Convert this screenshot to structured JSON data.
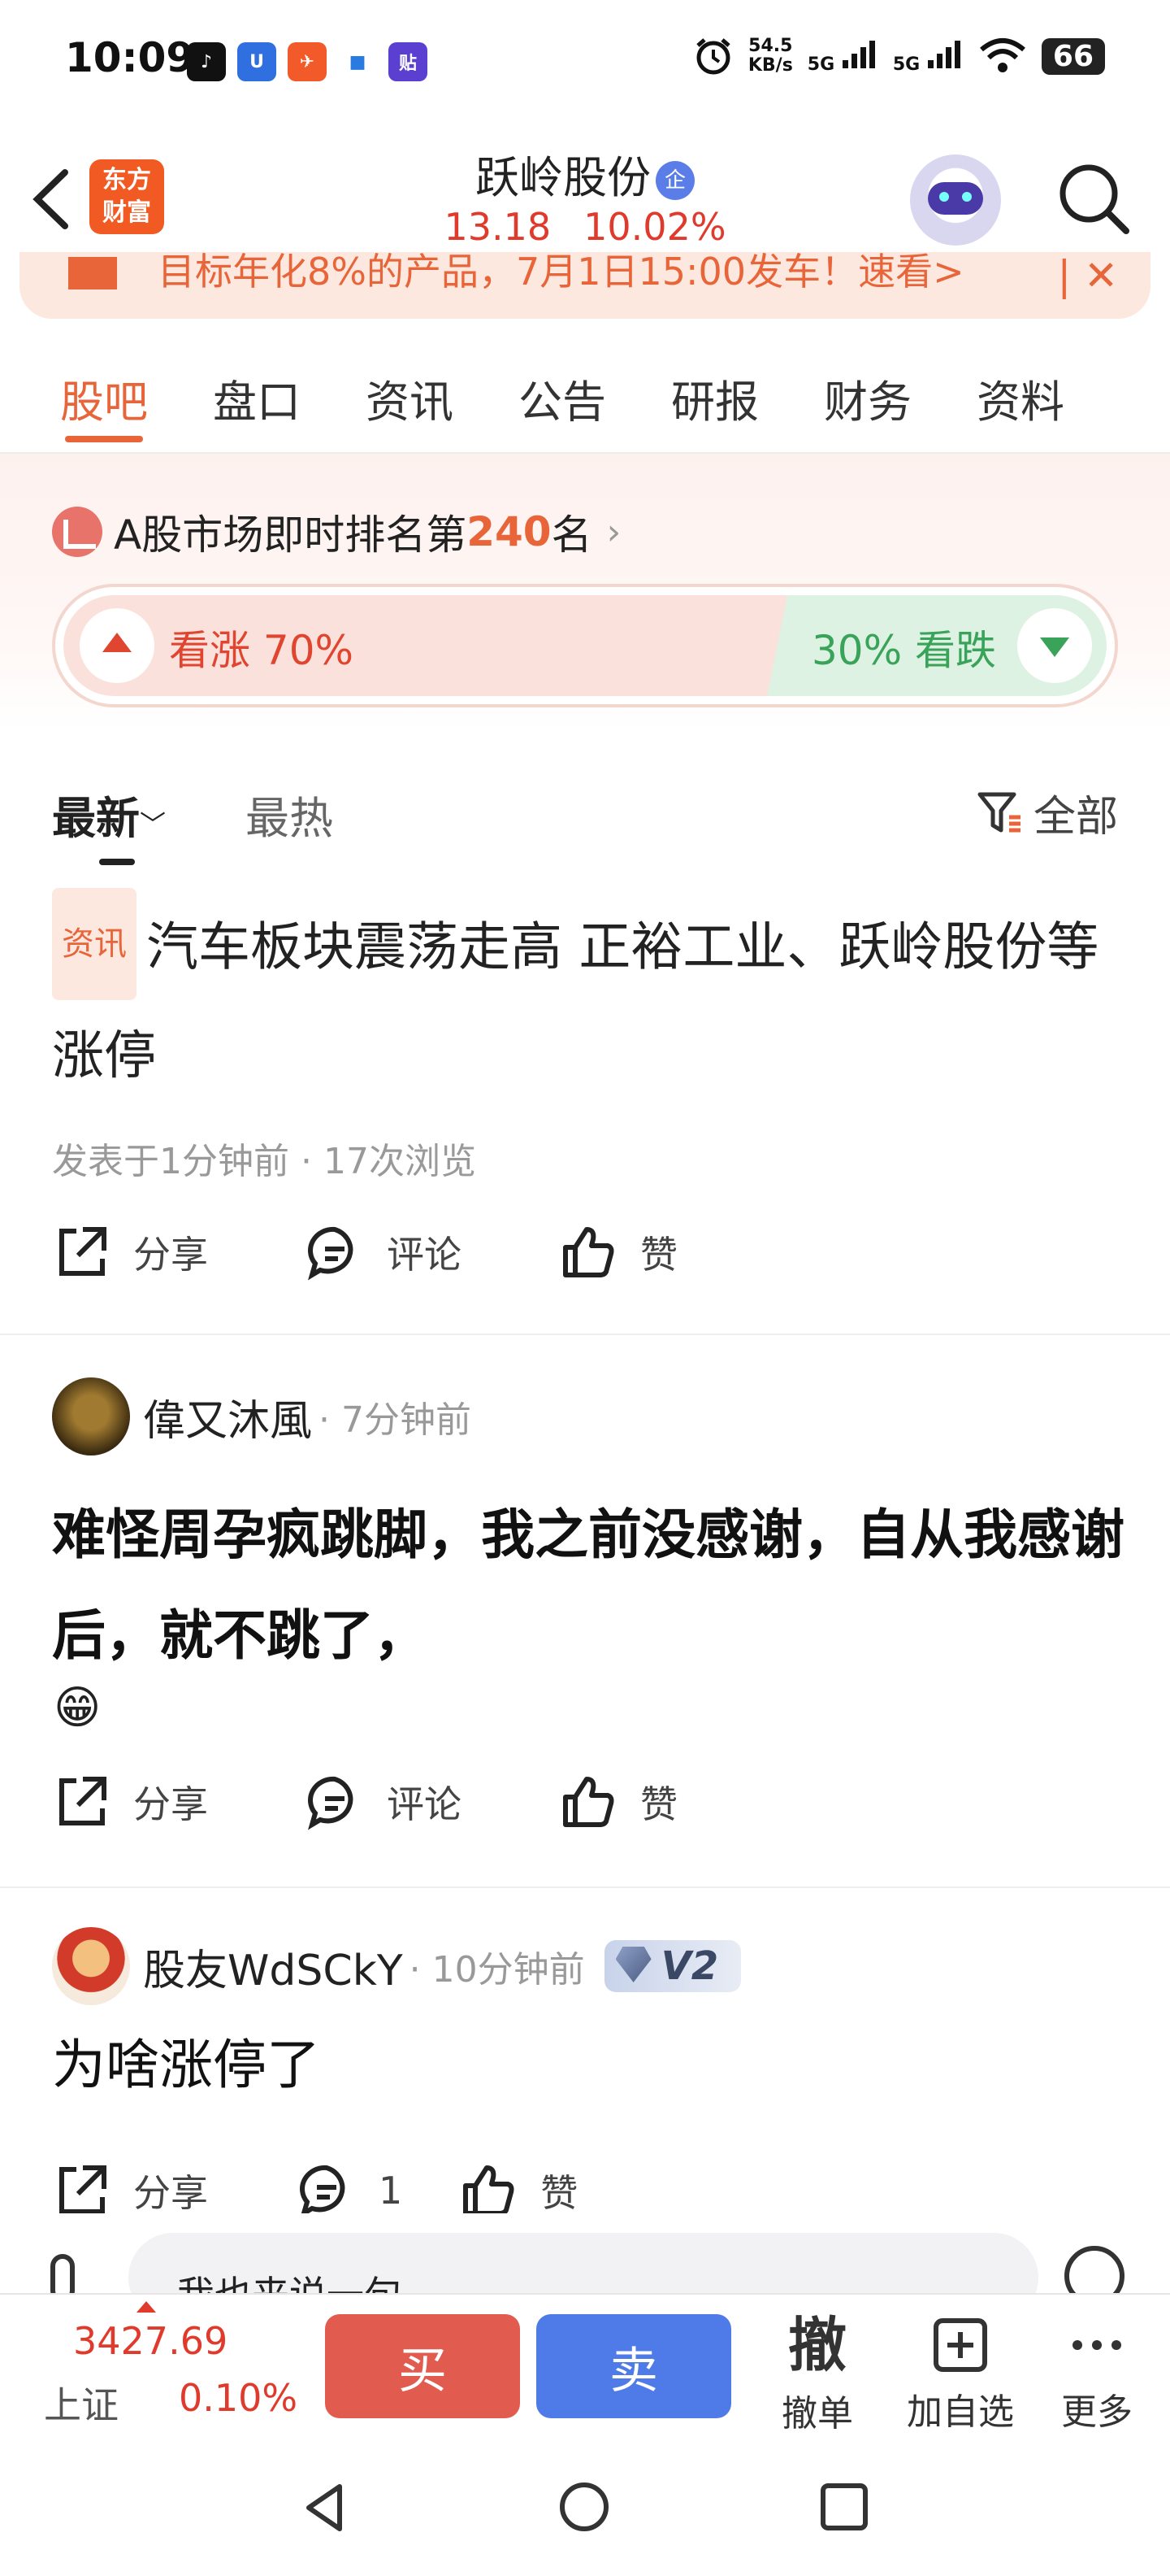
{
  "status_bar": {
    "time": "10:09",
    "net_speed_value": "54.5",
    "net_speed_unit": "KB/s",
    "signal1": "5G",
    "signal2": "5G",
    "battery": "66",
    "app_icons": [
      "tiktok-icon",
      "app-u-icon",
      "flag-app-icon",
      "cloud-app-icon",
      "tieba-icon"
    ]
  },
  "header": {
    "logo_line1": "东方",
    "logo_line2": "财富",
    "stock_name": "跃岭股份",
    "verified_badge": "企",
    "price": "13.18",
    "change_pct": "10.02%"
  },
  "promo": {
    "text": "目标年化8%的产品，7月1日15:00发车！速看>"
  },
  "tabs": [
    "股吧",
    "盘口",
    "资讯",
    "公告",
    "研报",
    "财务",
    "资料"
  ],
  "ranking": {
    "prefix": "A股市场即时排名第",
    "rank": "240",
    "suffix": "名",
    "bull_label": "看涨",
    "bull_pct": "70%",
    "bear_label": "看跌",
    "bear_pct": "30%",
    "bull_fraction": 0.7
  },
  "sort": {
    "latest": "最新",
    "hot": "最热",
    "filter": "全部"
  },
  "posts": [
    {
      "tag": "资讯",
      "title": "汽车板块震荡走高 正裕工业、跃岭股份等涨停",
      "meta": "发表于1分钟前 · 17次浏览",
      "share": "分享",
      "comment": "评论",
      "like": "赞"
    },
    {
      "author": "偉又沐風",
      "time": "· 7分钟前",
      "body": "难怪周孕疯跳脚，我之前没感谢，自从我感谢后，就不跳了，",
      "emoji": "😁",
      "share": "分享",
      "comment": "评论",
      "like": "赞"
    },
    {
      "author": "股友WdSCkY",
      "time": "· 10分钟前",
      "vip": "V2",
      "body": "为啥涨停了",
      "share": "分享",
      "comment": "1",
      "like": "赞"
    }
  ],
  "comment_input": {
    "placeholder": "我也来说一句"
  },
  "trade_bar": {
    "index_value": "3427.69",
    "index_name": "上证",
    "index_pct": "0.10%",
    "buy": "买",
    "sell": "卖",
    "cancel_icon_text": "撤",
    "cancel_label": "撤单",
    "add_label": "加自选",
    "more_label": "更多"
  },
  "colors": {
    "accent": "#e8653a",
    "up_red": "#e03a2c",
    "down_green": "#3aa35a",
    "buy": "#e25b4f",
    "sell": "#4f7be8"
  }
}
